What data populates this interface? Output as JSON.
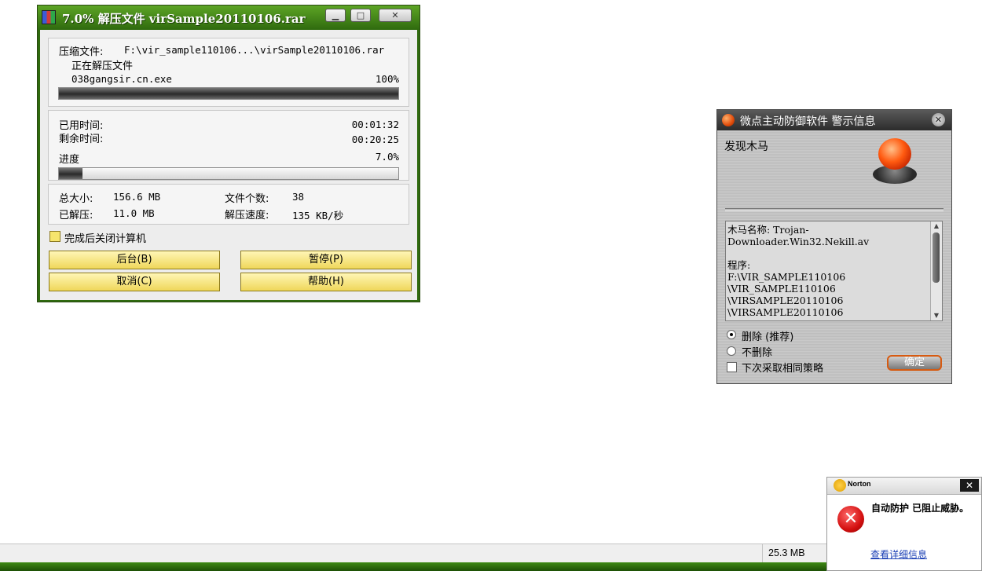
{
  "winrar": {
    "title": "7.0% 解压文件 virSample20110106.rar",
    "archive_label": "压缩文件:",
    "archive_path": "F:\\vir_sample110106...\\virSample20110106.rar",
    "status": "正在解压文件",
    "current_file": "038gangsir.cn.exe",
    "file_percent": "100%",
    "file_progress": 1.0,
    "elapsed_label": "已用时间:",
    "elapsed": "00:01:32",
    "remaining_label": "剩余时间:",
    "remaining": "00:20:25",
    "progress_label": "进度",
    "progress_percent": "7.0%",
    "total_progress": 0.07,
    "total_size_label": "总大小:",
    "total_size": "156.6 MB",
    "file_count_label": "文件个数:",
    "file_count": "38",
    "extracted_label": "已解压:",
    "extracted": "11.0 MB",
    "speed_label": "解压速度:",
    "speed": "135 KB/秒",
    "shutdown_label": "完成后关闭计算机",
    "buttons": {
      "background": "后台(B)",
      "pause": "暂停(P)",
      "cancel": "取消(C)",
      "help": "帮助(H)"
    }
  },
  "av_alert": {
    "title": "微点主动防御软件   警示信息",
    "heading": "发现木马",
    "details": [
      "木马名称: Trojan-",
      "Downloader.Win32.Nekill.av",
      "",
      "程序:",
      "F:\\VIR_SAMPLE110106",
      "\\VIR_SAMPLE110106",
      "\\VIRSAMPLE20110106",
      "\\VIRSAMPLE20110106"
    ],
    "option_delete": "删除 (推荐)",
    "option_keep": "不删除",
    "remember_label": "下次采取相同策略",
    "ok_button": "确定"
  },
  "statusbar": {
    "size": "25.3 MB"
  },
  "norton": {
    "brand": "Norton",
    "message": "自动防护 已阻止威胁。",
    "link": "查看详细信息"
  }
}
